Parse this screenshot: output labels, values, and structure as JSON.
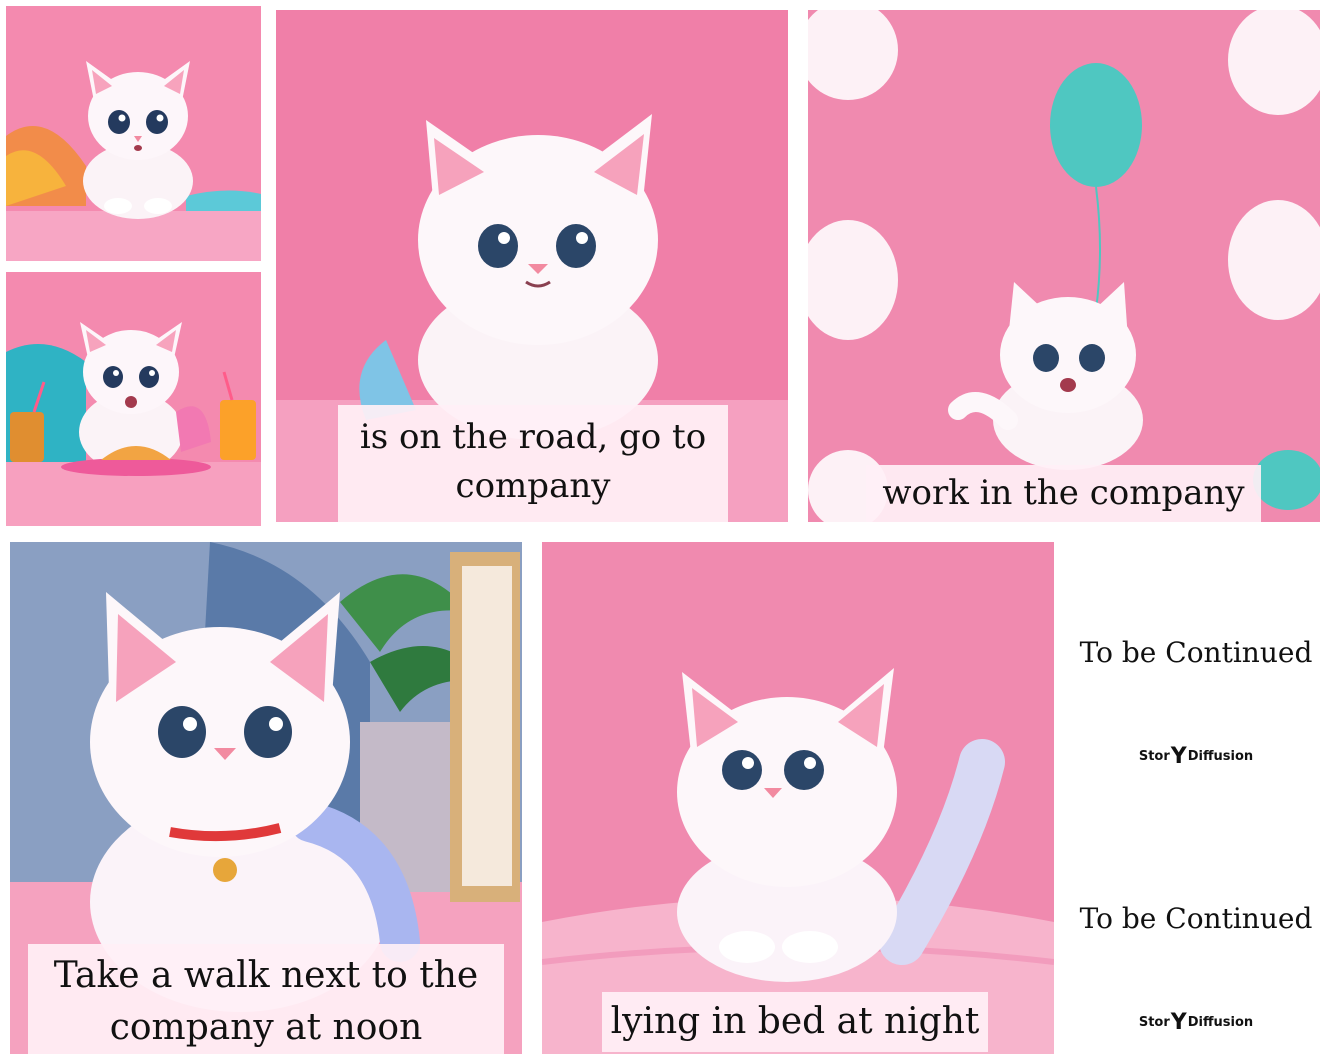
{
  "panels": [
    {
      "id": "p1",
      "caption": ""
    },
    {
      "id": "p2",
      "caption": ""
    },
    {
      "id": "p3",
      "caption": "is on the road, go to company"
    },
    {
      "id": "p4",
      "caption": "work in the company"
    },
    {
      "id": "p5",
      "caption": "Take a walk next to the company at noon"
    },
    {
      "id": "p6",
      "caption": "lying in bed at night"
    }
  ],
  "end_cards": [
    {
      "text": "To be Continued",
      "brand_left": "Stor",
      "brand_mark": "Y",
      "brand_right": "Diffusion"
    },
    {
      "text": "To be Continued",
      "brand_left": "Stor",
      "brand_mark": "Y",
      "brand_right": "Diffusion"
    }
  ],
  "colors": {
    "background_pink": "#ee7fa5",
    "caption_bg": "#fff0f6",
    "balloon": "#4fc7c1"
  },
  "icons": [
    "cat-illustration",
    "balloon-icon",
    "orange-juice-glass",
    "croissant-plate",
    "plant-leaves",
    "bed-cushion",
    "storydiffusion-logo"
  ]
}
